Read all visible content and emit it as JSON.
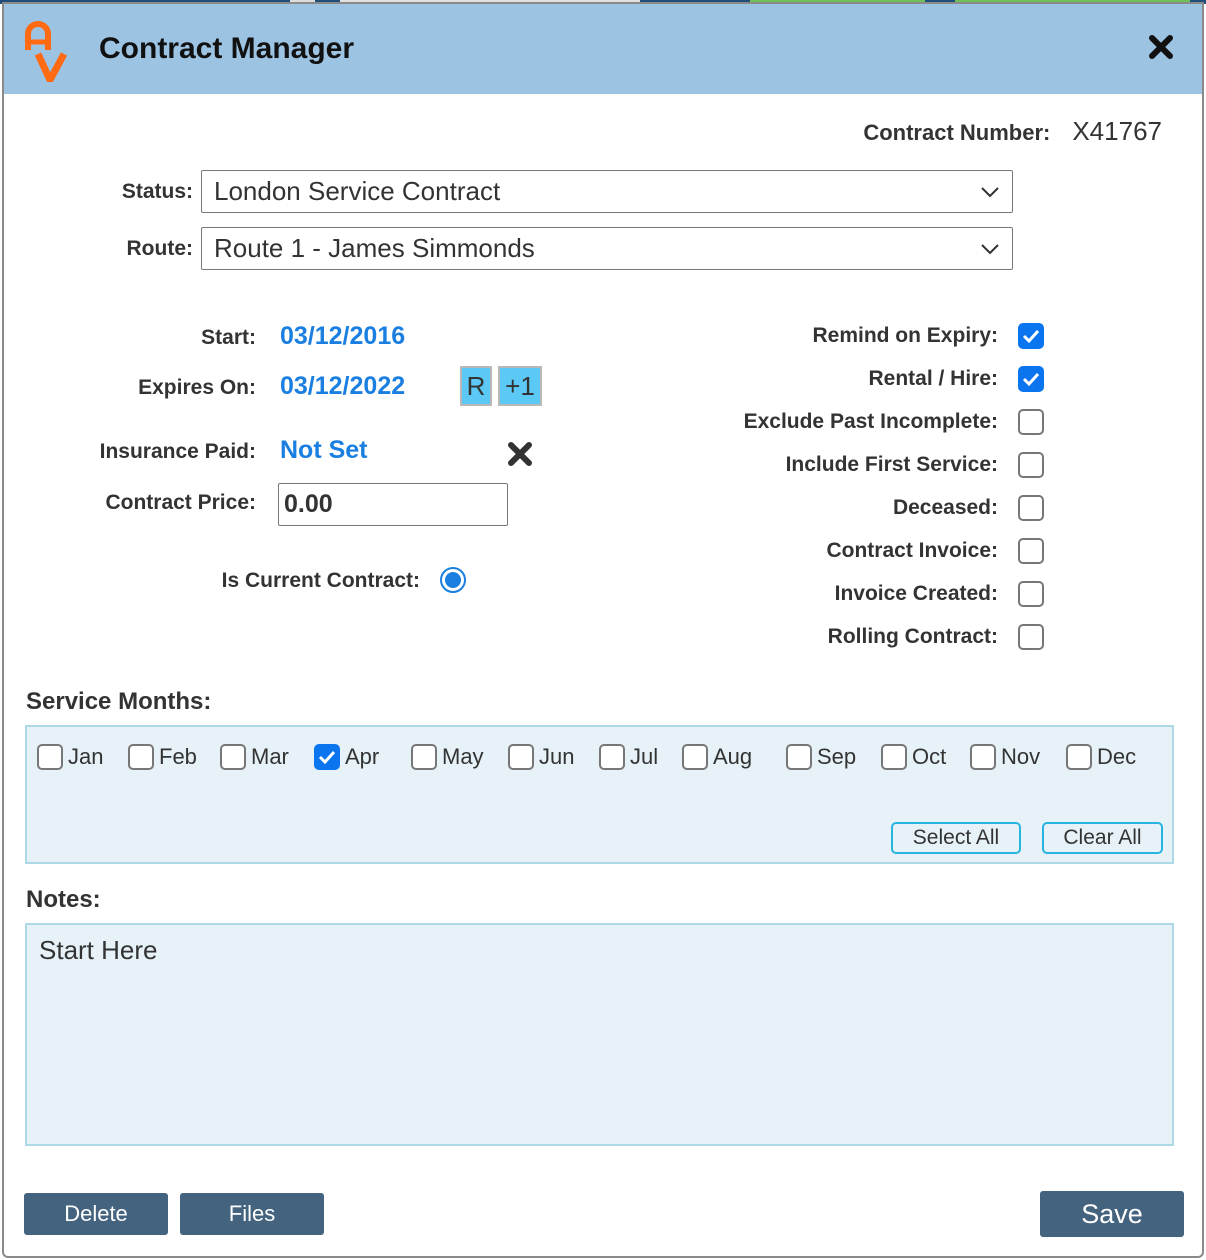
{
  "dialog": {
    "title": "Contract Manager",
    "logo_icon": "av-logo-icon",
    "close_icon": "close-icon",
    "title_bar_color": "#9dc3e3"
  },
  "contract_number": {
    "label": "Contract Number:",
    "value": "X41767"
  },
  "status": {
    "label": "Status:",
    "value": "London Service Contract"
  },
  "route": {
    "label": "Route:",
    "value": "Route 1 - James Simmonds"
  },
  "left_fields": {
    "start": {
      "label": "Start:",
      "value": "03/12/2016"
    },
    "expires": {
      "label": "Expires On:",
      "value": "03/12/2022",
      "reset_label": "R",
      "plus_one_label": "+1"
    },
    "insurance": {
      "label": "Insurance Paid:",
      "value": "Not Set"
    },
    "price": {
      "label": "Contract Price:",
      "value": "0.00"
    },
    "is_current": {
      "label": "Is Current Contract:",
      "selected": true
    }
  },
  "right_flags": [
    {
      "label": "Remind on Expiry:",
      "checked": true
    },
    {
      "label": "Rental / Hire:",
      "checked": true
    },
    {
      "label": "Exclude Past Incomplete:",
      "checked": false
    },
    {
      "label": "Include First Service:",
      "checked": false
    },
    {
      "label": "Deceased:",
      "checked": false
    },
    {
      "label": "Contract Invoice:",
      "checked": false
    },
    {
      "label": "Invoice Created:",
      "checked": false
    },
    {
      "label": "Rolling Contract:",
      "checked": false
    }
  ],
  "service_months": {
    "title": "Service Months:",
    "months": [
      {
        "label": "Jan",
        "checked": false
      },
      {
        "label": "Feb",
        "checked": false
      },
      {
        "label": "Mar",
        "checked": false
      },
      {
        "label": "Apr",
        "checked": true
      },
      {
        "label": "May",
        "checked": false
      },
      {
        "label": "Jun",
        "checked": false
      },
      {
        "label": "Jul",
        "checked": false
      },
      {
        "label": "Aug",
        "checked": false
      },
      {
        "label": "Sep",
        "checked": false
      },
      {
        "label": "Oct",
        "checked": false
      },
      {
        "label": "Nov",
        "checked": false
      },
      {
        "label": "Dec",
        "checked": false
      }
    ],
    "select_all_label": "Select All",
    "clear_all_label": "Clear All"
  },
  "notes": {
    "title": "Notes:",
    "value": "Start Here"
  },
  "footer": {
    "delete_label": "Delete",
    "files_label": "Files",
    "save_label": "Save"
  },
  "colors": {
    "accent": "#1a7fe0",
    "checkbox_checked": "#0a75ef",
    "button": "#44637f",
    "panel_bg": "#e6f2f8",
    "logo": "#ff6a13"
  }
}
